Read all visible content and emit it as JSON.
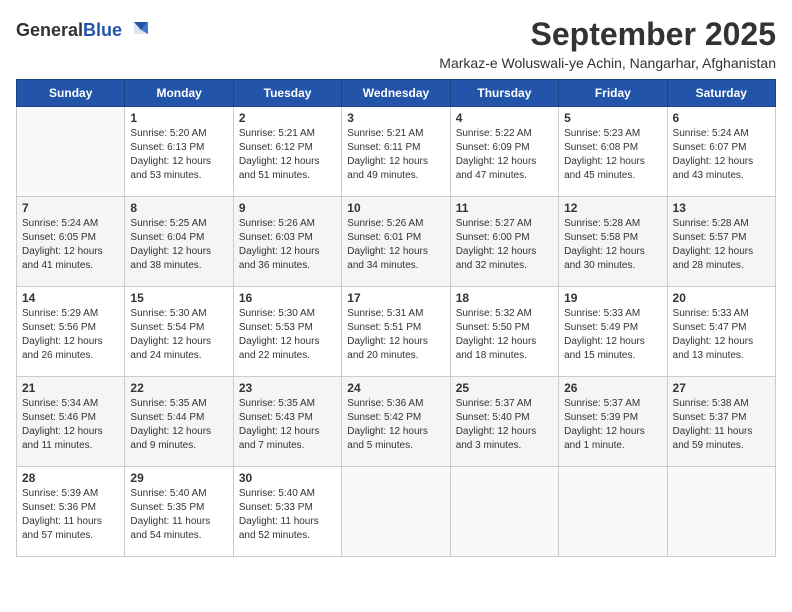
{
  "logo": {
    "general": "General",
    "blue": "Blue"
  },
  "title": "September 2025",
  "subtitle": "Markaz-e Woluswali-ye Achin, Nangarhar, Afghanistan",
  "weekdays": [
    "Sunday",
    "Monday",
    "Tuesday",
    "Wednesday",
    "Thursday",
    "Friday",
    "Saturday"
  ],
  "weeks": [
    [
      {
        "day": "",
        "info": ""
      },
      {
        "day": "1",
        "info": "Sunrise: 5:20 AM\nSunset: 6:13 PM\nDaylight: 12 hours\nand 53 minutes."
      },
      {
        "day": "2",
        "info": "Sunrise: 5:21 AM\nSunset: 6:12 PM\nDaylight: 12 hours\nand 51 minutes."
      },
      {
        "day": "3",
        "info": "Sunrise: 5:21 AM\nSunset: 6:11 PM\nDaylight: 12 hours\nand 49 minutes."
      },
      {
        "day": "4",
        "info": "Sunrise: 5:22 AM\nSunset: 6:09 PM\nDaylight: 12 hours\nand 47 minutes."
      },
      {
        "day": "5",
        "info": "Sunrise: 5:23 AM\nSunset: 6:08 PM\nDaylight: 12 hours\nand 45 minutes."
      },
      {
        "day": "6",
        "info": "Sunrise: 5:24 AM\nSunset: 6:07 PM\nDaylight: 12 hours\nand 43 minutes."
      }
    ],
    [
      {
        "day": "7",
        "info": "Sunrise: 5:24 AM\nSunset: 6:05 PM\nDaylight: 12 hours\nand 41 minutes."
      },
      {
        "day": "8",
        "info": "Sunrise: 5:25 AM\nSunset: 6:04 PM\nDaylight: 12 hours\nand 38 minutes."
      },
      {
        "day": "9",
        "info": "Sunrise: 5:26 AM\nSunset: 6:03 PM\nDaylight: 12 hours\nand 36 minutes."
      },
      {
        "day": "10",
        "info": "Sunrise: 5:26 AM\nSunset: 6:01 PM\nDaylight: 12 hours\nand 34 minutes."
      },
      {
        "day": "11",
        "info": "Sunrise: 5:27 AM\nSunset: 6:00 PM\nDaylight: 12 hours\nand 32 minutes."
      },
      {
        "day": "12",
        "info": "Sunrise: 5:28 AM\nSunset: 5:58 PM\nDaylight: 12 hours\nand 30 minutes."
      },
      {
        "day": "13",
        "info": "Sunrise: 5:28 AM\nSunset: 5:57 PM\nDaylight: 12 hours\nand 28 minutes."
      }
    ],
    [
      {
        "day": "14",
        "info": "Sunrise: 5:29 AM\nSunset: 5:56 PM\nDaylight: 12 hours\nand 26 minutes."
      },
      {
        "day": "15",
        "info": "Sunrise: 5:30 AM\nSunset: 5:54 PM\nDaylight: 12 hours\nand 24 minutes."
      },
      {
        "day": "16",
        "info": "Sunrise: 5:30 AM\nSunset: 5:53 PM\nDaylight: 12 hours\nand 22 minutes."
      },
      {
        "day": "17",
        "info": "Sunrise: 5:31 AM\nSunset: 5:51 PM\nDaylight: 12 hours\nand 20 minutes."
      },
      {
        "day": "18",
        "info": "Sunrise: 5:32 AM\nSunset: 5:50 PM\nDaylight: 12 hours\nand 18 minutes."
      },
      {
        "day": "19",
        "info": "Sunrise: 5:33 AM\nSunset: 5:49 PM\nDaylight: 12 hours\nand 15 minutes."
      },
      {
        "day": "20",
        "info": "Sunrise: 5:33 AM\nSunset: 5:47 PM\nDaylight: 12 hours\nand 13 minutes."
      }
    ],
    [
      {
        "day": "21",
        "info": "Sunrise: 5:34 AM\nSunset: 5:46 PM\nDaylight: 12 hours\nand 11 minutes."
      },
      {
        "day": "22",
        "info": "Sunrise: 5:35 AM\nSunset: 5:44 PM\nDaylight: 12 hours\nand 9 minutes."
      },
      {
        "day": "23",
        "info": "Sunrise: 5:35 AM\nSunset: 5:43 PM\nDaylight: 12 hours\nand 7 minutes."
      },
      {
        "day": "24",
        "info": "Sunrise: 5:36 AM\nSunset: 5:42 PM\nDaylight: 12 hours\nand 5 minutes."
      },
      {
        "day": "25",
        "info": "Sunrise: 5:37 AM\nSunset: 5:40 PM\nDaylight: 12 hours\nand 3 minutes."
      },
      {
        "day": "26",
        "info": "Sunrise: 5:37 AM\nSunset: 5:39 PM\nDaylight: 12 hours\nand 1 minute."
      },
      {
        "day": "27",
        "info": "Sunrise: 5:38 AM\nSunset: 5:37 PM\nDaylight: 11 hours\nand 59 minutes."
      }
    ],
    [
      {
        "day": "28",
        "info": "Sunrise: 5:39 AM\nSunset: 5:36 PM\nDaylight: 11 hours\nand 57 minutes."
      },
      {
        "day": "29",
        "info": "Sunrise: 5:40 AM\nSunset: 5:35 PM\nDaylight: 11 hours\nand 54 minutes."
      },
      {
        "day": "30",
        "info": "Sunrise: 5:40 AM\nSunset: 5:33 PM\nDaylight: 11 hours\nand 52 minutes."
      },
      {
        "day": "",
        "info": ""
      },
      {
        "day": "",
        "info": ""
      },
      {
        "day": "",
        "info": ""
      },
      {
        "day": "",
        "info": ""
      }
    ]
  ]
}
